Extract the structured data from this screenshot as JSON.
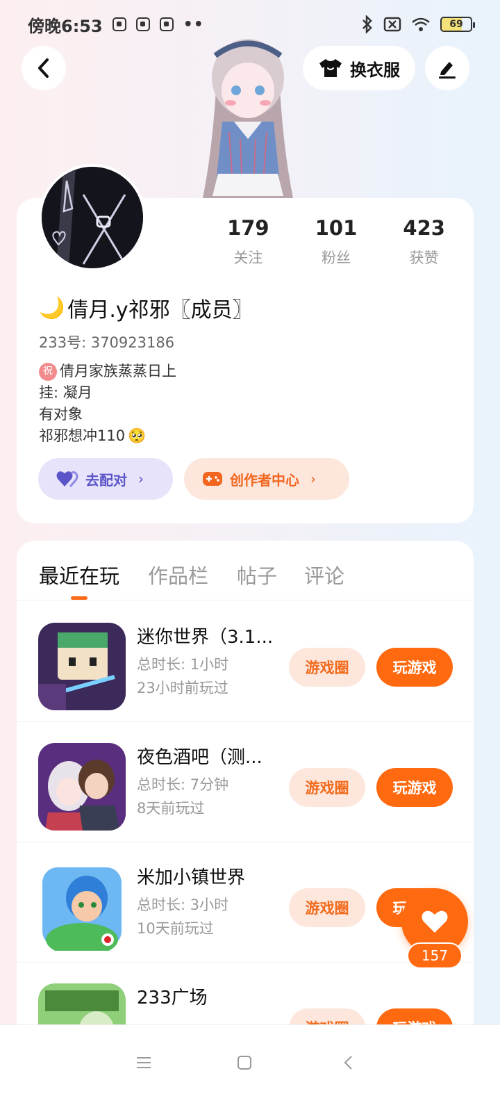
{
  "status_bar": {
    "time": "傍晚6:53",
    "dots": "••",
    "battery": "69"
  },
  "header": {
    "change_clothes_label": "换衣服"
  },
  "profile": {
    "stats": [
      {
        "value": "179",
        "label": "关注"
      },
      {
        "value": "101",
        "label": "粉丝"
      },
      {
        "value": "423",
        "label": "获赞"
      }
    ],
    "username_emoji": "🌙",
    "username": "倩月.y祁邪〖成员〗",
    "account_id": "233号: 370923186",
    "bio": {
      "badge": "祝",
      "line1": "倩月家族蒸蒸日上",
      "line2": "挂: 凝月",
      "line3": "有对象",
      "line4": "祁邪想冲110",
      "line4_emoji": "🥺"
    },
    "pair_label": "去配对",
    "creator_label": "创作者中心",
    "chevron": "›"
  },
  "tabs": [
    {
      "label": "最近在玩"
    },
    {
      "label": "作品栏"
    },
    {
      "label": "帖子"
    },
    {
      "label": "评论"
    }
  ],
  "games": [
    {
      "title": "迷你世界（3.1...",
      "time": "总时长: 1小时",
      "last_played": "23小时前玩过",
      "circle": "游戏圈",
      "play": "玩游戏"
    },
    {
      "title": "夜色酒吧（测...",
      "time": "总时长: 7分钟",
      "last_played": "8天前玩过",
      "circle": "游戏圈",
      "play": "玩游戏"
    },
    {
      "title": "米加小镇世界",
      "time": "总时长: 3小时",
      "last_played": "10天前玩过",
      "circle": "游戏圈",
      "play": "玩游戏"
    },
    {
      "title": "233广场",
      "time": "",
      "last_played": "",
      "circle": "游戏圈",
      "play": "玩游戏"
    }
  ],
  "like_count": "157",
  "colors": {
    "accent": "#ff6a10",
    "accent_soft": "#fde6dc",
    "pair": "#5b55c9"
  }
}
